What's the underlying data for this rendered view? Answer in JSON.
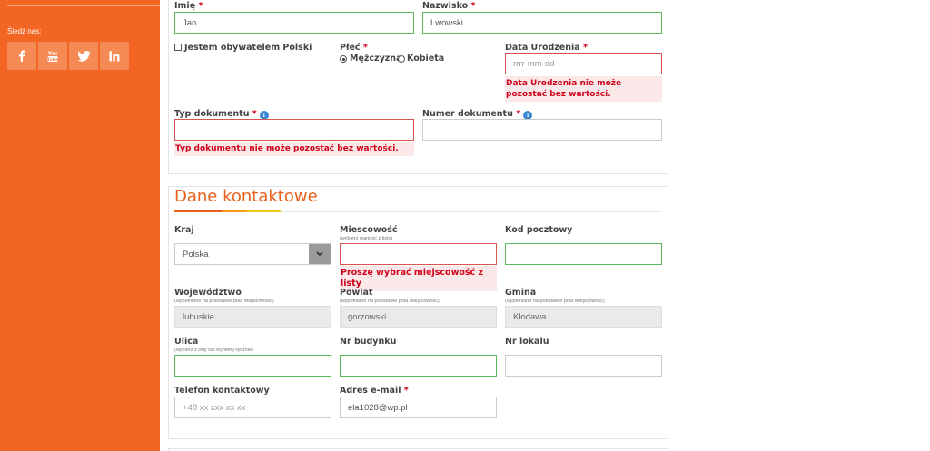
{
  "sidebar": {
    "follow_label": "Śledź nas:",
    "social": [
      "facebook-icon",
      "youtube-icon",
      "twitter-icon",
      "linkedin-icon"
    ]
  },
  "personal": {
    "first_name": {
      "label": "Imię",
      "value": "Jan"
    },
    "last_name": {
      "label": "Nazwisko",
      "value": "Lwowski"
    },
    "citizen_checkbox": {
      "label": "Jestem obywatelem Polski",
      "checked": false
    },
    "gender": {
      "label": "Płeć",
      "options": [
        "Mężczyzna",
        "Kobieta"
      ],
      "selected": "Mężczyzna"
    },
    "birth_date": {
      "label": "Data Urodzenia",
      "placeholder": "rrrr-mm-dd",
      "error": "Data Urodzenia nie może pozostać bez wartości."
    },
    "doc_type": {
      "label": "Typ dokumentu",
      "value": "",
      "error": "Typ dokumentu nie może pozostać bez wartości."
    },
    "doc_number": {
      "label": "Numer dokumentu",
      "value": ""
    }
  },
  "contact": {
    "title": "Dane kontaktowe",
    "country": {
      "label": "Kraj",
      "value": "Polska"
    },
    "city": {
      "label": "Miescowość",
      "hint": "(wybierz wartość z listy)",
      "value": "",
      "error": "Proszę wybrać miejscowość z listy"
    },
    "postal_code": {
      "label": "Kod pocztowy",
      "value": ""
    },
    "voivodeship": {
      "label": "Województwo",
      "hint": "(wypełniane na podstawie pola Miejscowość)",
      "value": "lubuskie"
    },
    "county": {
      "label": "Powiat",
      "hint": "(wypełniane na podstawie pola Miejscowość)",
      "value": "gorzowski"
    },
    "commune": {
      "label": "Gmina",
      "hint": "(wypełniane na podstawie pola Miejscowość)",
      "value": "Kłodawa"
    },
    "street": {
      "label": "Ulica",
      "hint": "(wybierz z listy lub wypełnij ręcznie)",
      "value": ""
    },
    "building_no": {
      "label": "Nr budynku",
      "value": ""
    },
    "apartment_no": {
      "label": "Nr lokalu",
      "value": ""
    },
    "phone": {
      "label": "Telefon kontaktowy",
      "placeholder": "+48 xx xxx xx xx"
    },
    "email": {
      "label": "Adres e-mail",
      "value": "ela1028@wp.pl"
    }
  },
  "colors": {
    "sidebar": "#f26522",
    "accent_title": "#e8601c",
    "valid_border": "#5cb85c",
    "invalid_border": "#d9534f",
    "error_text": "#d0021b",
    "title_bar_segments": [
      "#e8601c",
      "#f39c12",
      "#f5c518"
    ]
  }
}
